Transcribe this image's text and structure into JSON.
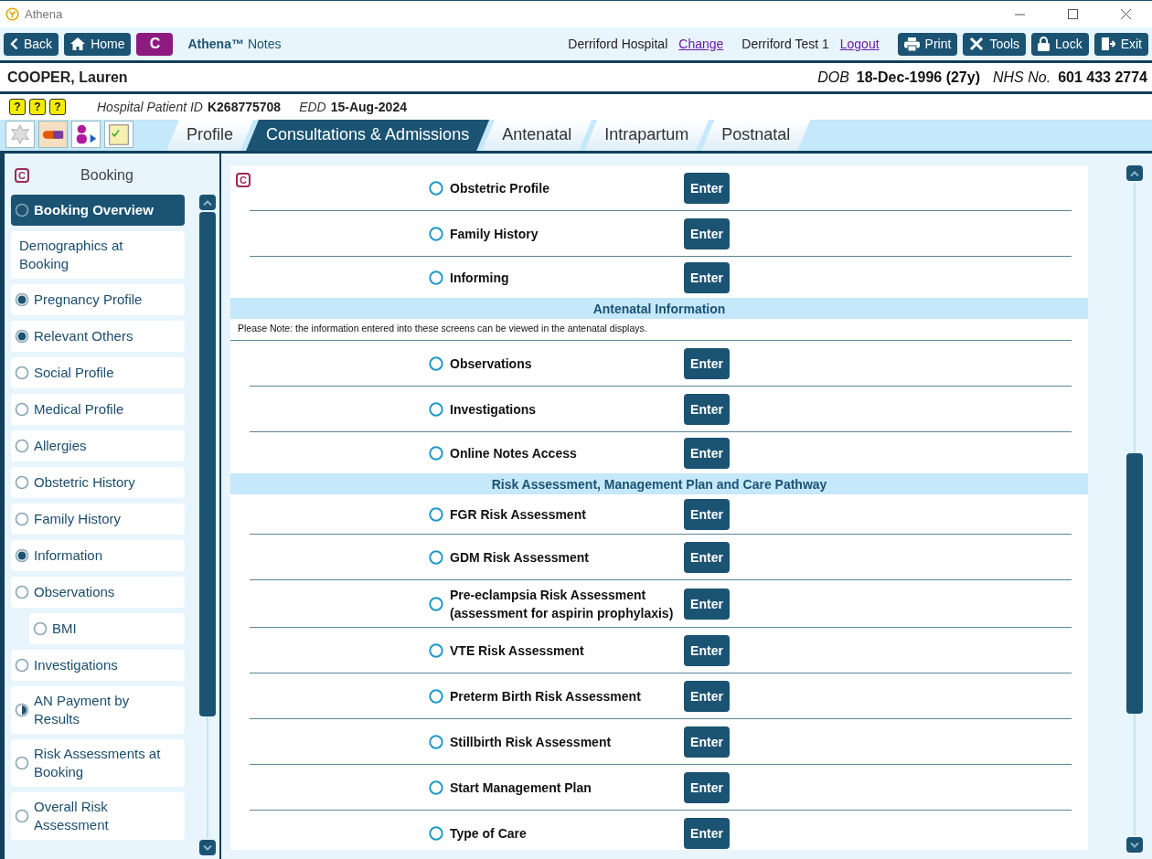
{
  "window": {
    "title": "Athena"
  },
  "toolbar": {
    "nav_buttons": [
      {
        "label": "Back"
      },
      {
        "label": "Home"
      }
    ],
    "c_button": "C",
    "app_name": "Athena™",
    "app_suffix": "Notes",
    "hospital": "Derriford Hospital",
    "change_link": "Change",
    "user": "Derriford Test 1",
    "logout_link": "Logout",
    "action_buttons": [
      {
        "label": "Print"
      },
      {
        "label": "Tools"
      },
      {
        "label": "Lock"
      },
      {
        "label": "Exit"
      }
    ]
  },
  "patient": {
    "name": "COOPER, Lauren",
    "dob_label": "DOB",
    "dob": "18-Dec-1996 (27y)",
    "nhs_label": "NHS No.",
    "nhs": "601 433 2774",
    "alert_icons": [
      "?",
      "?",
      "?"
    ],
    "hospital_id_label": "Hospital Patient ID",
    "hospital_id": "K268775708",
    "edd_label": "EDD",
    "edd": "15-Aug-2024"
  },
  "tabs": [
    {
      "label": "Profile",
      "selected": false
    },
    {
      "label": "Consultations & Admissions",
      "selected": true
    },
    {
      "label": "Antenatal",
      "selected": false
    },
    {
      "label": "Intrapartum",
      "selected": false
    },
    {
      "label": "Postnatal",
      "selected": false
    }
  ],
  "sidebar": {
    "badge": "C",
    "title": "Booking",
    "items": [
      {
        "label": "Booking Overview",
        "radio": true,
        "checked": false,
        "partial": false,
        "selected": true
      },
      {
        "label": "Demographics at Booking",
        "radio": false,
        "selected": false
      },
      {
        "label": "Pregnancy Profile",
        "radio": true,
        "checked": true,
        "partial": false,
        "selected": false
      },
      {
        "label": "Relevant Others",
        "radio": true,
        "checked": true,
        "partial": false,
        "selected": false
      },
      {
        "label": "Social Profile",
        "radio": true,
        "checked": false,
        "partial": false,
        "selected": false
      },
      {
        "label": "Medical Profile",
        "radio": true,
        "checked": false,
        "partial": false,
        "selected": false
      },
      {
        "label": "Allergies",
        "radio": true,
        "checked": false,
        "partial": false,
        "selected": false
      },
      {
        "label": "Obstetric History",
        "radio": true,
        "checked": false,
        "partial": false,
        "selected": false
      },
      {
        "label": "Family History",
        "radio": true,
        "checked": false,
        "partial": false,
        "selected": false
      },
      {
        "label": "Information",
        "radio": true,
        "checked": true,
        "partial": false,
        "selected": false
      },
      {
        "label": "Observations",
        "radio": true,
        "checked": false,
        "partial": false,
        "selected": false,
        "children": [
          {
            "label": "BMI",
            "radio": true,
            "checked": false,
            "partial": false,
            "selected": false
          }
        ]
      },
      {
        "label": "Investigations",
        "radio": true,
        "checked": false,
        "partial": false,
        "selected": false
      },
      {
        "label": "AN Payment by Results",
        "radio": true,
        "checked": false,
        "partial": true,
        "selected": false
      },
      {
        "label": "Risk Assessments at Booking",
        "radio": true,
        "checked": false,
        "partial": false,
        "selected": false
      },
      {
        "label": "Overall Risk Assessment",
        "radio": true,
        "checked": false,
        "partial": false,
        "selected": false
      }
    ]
  },
  "content": {
    "badge": "C",
    "rows": [
      {
        "kind": "item",
        "label": "Obstetric Profile",
        "checked": false,
        "button": "Enter"
      },
      {
        "kind": "item",
        "label": "Family History",
        "checked": false,
        "button": "Enter"
      },
      {
        "kind": "item",
        "label": "Informing",
        "checked": false,
        "button": "Enter"
      },
      {
        "kind": "heading",
        "label": "Antenatal Information"
      },
      {
        "kind": "note",
        "label": "Please Note: the information entered into these screens can be viewed in the antenatal displays."
      },
      {
        "kind": "item",
        "label": "Observations",
        "checked": false,
        "button": "Enter"
      },
      {
        "kind": "item",
        "label": "Investigations",
        "checked": false,
        "button": "Enter"
      },
      {
        "kind": "item",
        "label": "Online Notes Access",
        "checked": false,
        "button": "Enter"
      },
      {
        "kind": "heading",
        "label": "Risk Assessment, Management Plan and Care Pathway"
      },
      {
        "kind": "item",
        "label": "FGR Risk Assessment",
        "checked": false,
        "button": "Enter"
      },
      {
        "kind": "item",
        "label": "GDM Risk Assessment",
        "checked": false,
        "button": "Enter"
      },
      {
        "kind": "item",
        "label": "Pre-eclampsia Risk Assessment (assessment for aspirin prophylaxis)",
        "checked": false,
        "button": "Enter"
      },
      {
        "kind": "item",
        "label": "VTE Risk Assessment",
        "checked": false,
        "button": "Enter"
      },
      {
        "kind": "item",
        "label": "Preterm Birth Risk Assessment",
        "checked": false,
        "button": "Enter"
      },
      {
        "kind": "item",
        "label": "Stillbirth Risk Assessment",
        "checked": false,
        "button": "Enter"
      },
      {
        "kind": "item",
        "label": "Start Management Plan",
        "checked": false,
        "button": "Enter"
      },
      {
        "kind": "item",
        "label": "Type of Care",
        "checked": false,
        "button": "Enter"
      }
    ]
  }
}
